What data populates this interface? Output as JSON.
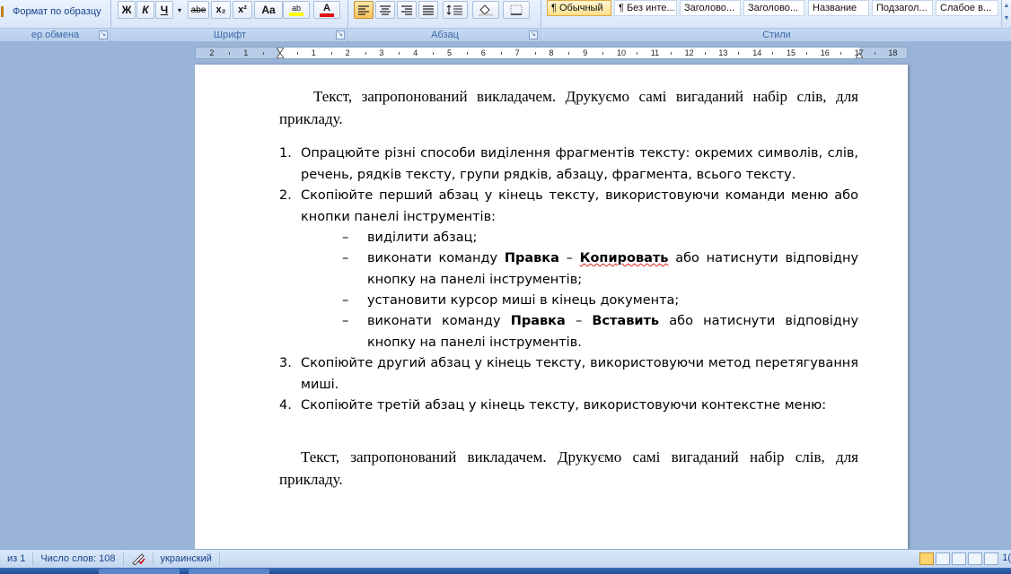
{
  "ribbon": {
    "clipboard": {
      "format_painter": "Формат по образцу",
      "caption": "ер обмена"
    },
    "font": {
      "caption": "Шрифт",
      "buttons": [
        "Ж",
        "К",
        "Ч",
        "abe",
        "x₂",
        "x²",
        "Aa"
      ],
      "highlight_label": "ab",
      "font_color_label": "A"
    },
    "paragraph": {
      "caption": "Абзац"
    },
    "styles": {
      "caption": "Стили",
      "items": [
        "¶ Обычный",
        "¶ Без инте...",
        "Заголово...",
        "Заголово...",
        "Название",
        "Подзагол...",
        "Слабое в..."
      ]
    }
  },
  "ruler": {
    "labels": [
      "2",
      "1",
      "1",
      "1",
      "2",
      "3",
      "4",
      "5",
      "6",
      "7",
      "8",
      "9",
      "10",
      "11",
      "12",
      "13",
      "14",
      "15",
      "16",
      "17",
      "18"
    ]
  },
  "document": {
    "para1": "Текст, запропонований викладачем. Друкуємо самі вигаданий набір слів, для прикладу.",
    "list": [
      {
        "num": "1.",
        "text": "Опрацюйте різні способи виділення фрагментів тексту: окремих символів, слів, речень, рядків тексту, групи рядків, абзацу, фрагмента, всього тексту."
      },
      {
        "num": "2.",
        "text": "Скопіюйте перший абзац у кінець тексту, використовуючи команди меню або кнопки панелі інструментів:"
      },
      {
        "num": "3.",
        "text": "Скопіюйте другий абзац у кінець тексту, використовуючи метод перетягування миші."
      },
      {
        "num": "4.",
        "text": "Скопіюйте третій абзац у кінець тексту, використовуючи контекстне меню:"
      }
    ],
    "sublist": {
      "dash": "–",
      "s1": "виділити абзац;",
      "s2_pre": "виконати команду",
      "s2_b1": "Правка",
      "s2_sep": "–",
      "s2_b2": "Копировать",
      "s2_post": "або натиснути відповідну кнопку на панелі інструментів;",
      "s3": "установити курсор миші в кінець документа;",
      "s4_pre": "виконати команду",
      "s4_b1": "Правка",
      "s4_sep": "–",
      "s4_b2": "Вставить",
      "s4_post": "або натиснути відповідну кнопку на панелі інструментів."
    },
    "para_end": "Текст, запропонований викладачем. Друкуємо самі вигаданий набір слів, для прикладу."
  },
  "status": {
    "page": "из 1",
    "words": "Число слов: 108",
    "language": "украинский",
    "zoom": "1("
  }
}
